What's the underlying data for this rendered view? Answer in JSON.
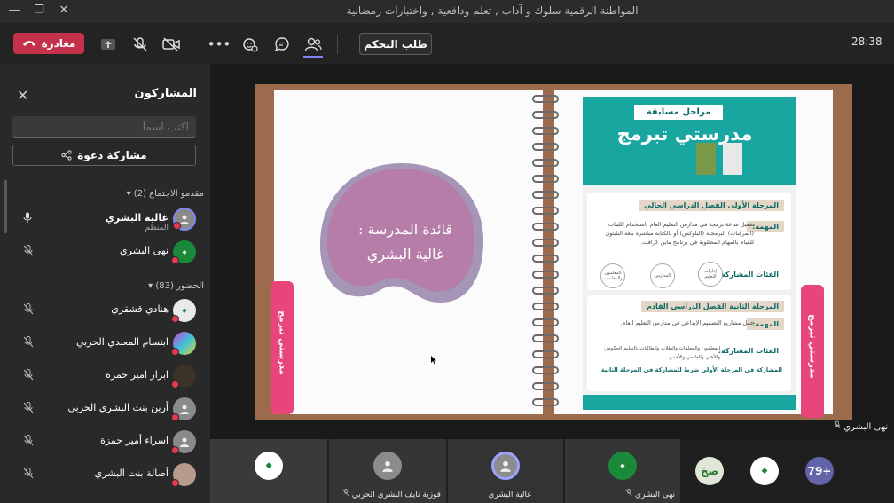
{
  "window": {
    "title": "المواطنة الرقمية سلوك و آداب , تعلم ودافعية , واختبارات رمضانية",
    "buttons": [
      "minimize-icon",
      "restore-icon",
      "close-icon"
    ]
  },
  "toolbar": {
    "leave_label": "مغادرة",
    "request_control_label": "طلب التحكم",
    "timer": "28:38",
    "icons": [
      "share-tray-icon",
      "mic-off-icon",
      "camera-off-icon",
      "more-icon",
      "reactions-icon",
      "chat-icon",
      "people-icon"
    ]
  },
  "sidebar": {
    "title": "المشاركون",
    "search_placeholder": "اكتب اسماً",
    "invite_label": "مشاركة دعوة",
    "presenters_header": "مقدمو الاجتماع (2)",
    "attendees_header": "الحضور (83)",
    "presenters": [
      {
        "name": "غالية البشري",
        "role": "المنظم",
        "mic": "mic-on"
      },
      {
        "name": "نهى البشري",
        "role": "",
        "mic": "mic-off"
      }
    ],
    "attendees": [
      {
        "name": "هنادي قشقري",
        "mic": "mic-off"
      },
      {
        "name": "ابتسام المعبدي الحربي",
        "mic": "mic-off"
      },
      {
        "name": "ابرار امير حمزة",
        "mic": "mic-off"
      },
      {
        "name": "أرين بنت البشري الحربي",
        "mic": "mic-off"
      },
      {
        "name": "اسراء أمير حمزة",
        "mic": "mic-off"
      },
      {
        "name": "أصالة بنت البشري",
        "mic": "mic-off"
      }
    ]
  },
  "slide": {
    "teacher_line1": "قائدة المدرسة :",
    "teacher_line2": "غالية البشري",
    "tab_text": "مدرستي تبرمج",
    "poster": {
      "badge": "مراحل مسابقة",
      "title": "مدرستي تبرمج",
      "stage1_title": "المرحلة الأولى الفصل الدراسي الحالي",
      "stage1_task_tag": "المهمة:",
      "stage1_task": "تفعيل ساعة برمجة في مدارس التعليم العام باستخدام اللبنات (المركبات) البرمجية (البلوكس) أو بالكتابة مباشرة بلغة البايثون للقيام بالمهام المطلوبة في برنامج ماين كرافت.",
      "stage1_participants_tag": "الفئات المشاركة:",
      "stage1_circles": [
        "إدارات التعليم",
        "المدارس",
        "المعلمون والمعلمات"
      ],
      "stage2_title": "المرحلة الثانية الفصل الدراسي القادم",
      "stage2_task_tag": "المهمة:",
      "stage2_task": "عمل مشاريع التصميم الإبداعي في مدارس التعليم العام.",
      "stage2_participants_tag": "الفئات المشاركة:",
      "stage2_participants": "المعلمون والمعلمات والطلاب والطالبات بالتعليم الحكومي والأهلي والعالمي والأجنبي",
      "stage2_note": "المشاركة في المرحلة الأولى شرط للمشاركة في المرحلة الثانية"
    }
  },
  "stage": {
    "speaker_label": "نهى البشري"
  },
  "gallery": {
    "tiles": [
      {
        "name": "",
        "avatar": "logo"
      },
      {
        "name": "فوزية نايف البشري الحربي",
        "avatar": "person"
      },
      {
        "name": "غالية البشري",
        "avatar": "person"
      },
      {
        "name": "نهى البشري",
        "avatar": "logo"
      }
    ],
    "sobh_label": "صخ",
    "overflow_label": "79+"
  },
  "colors": {
    "leave": "#c4314b",
    "accent": "#7f85f5",
    "poster_teal": "#1aa6a0",
    "tab_pink": "#e8457a",
    "blob": "#b57da7"
  }
}
